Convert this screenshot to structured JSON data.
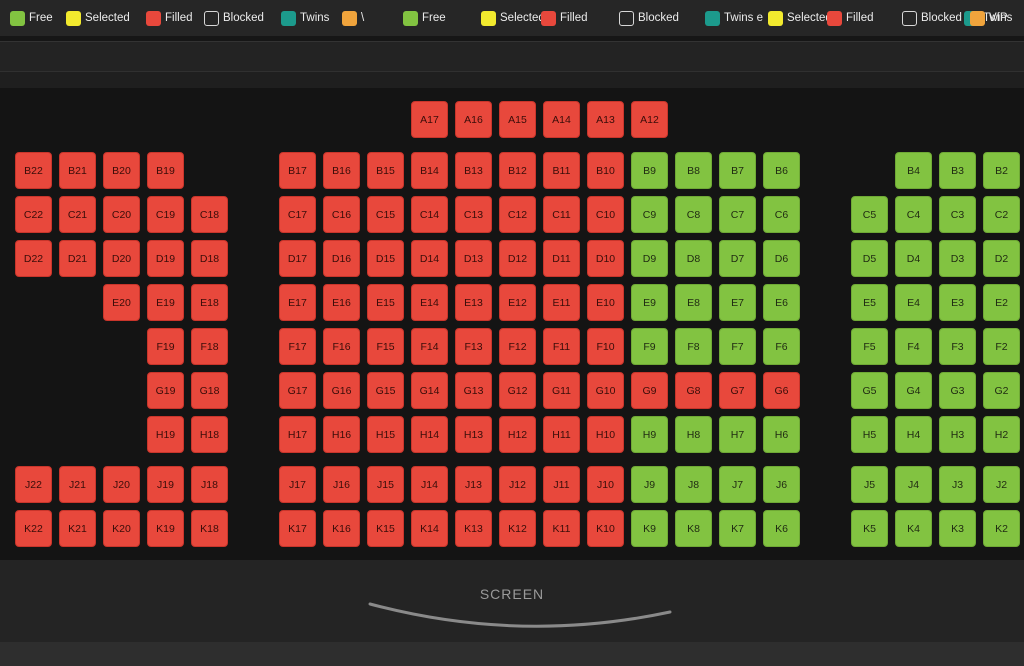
{
  "legend": [
    {
      "label": "Free",
      "status": "free"
    },
    {
      "label": "Selected",
      "status": "selected"
    },
    {
      "label": "Filled",
      "status": "filled"
    },
    {
      "label": "Blocked",
      "status": "blocked"
    },
    {
      "label": "Twins",
      "status": "twins"
    },
    {
      "label": "\\",
      "status": "vip"
    },
    {
      "label": "Free",
      "status": "free"
    },
    {
      "label": "Selected",
      "status": "selected"
    },
    {
      "label": "Filled",
      "status": "filled"
    },
    {
      "label": "Blocked",
      "status": "blocked"
    },
    {
      "label": "Twins e",
      "status": "twins"
    },
    {
      "label": "Selected",
      "status": "selected"
    },
    {
      "label": "Filled",
      "status": "filled"
    },
    {
      "label": "Blocked",
      "status": "blocked"
    },
    {
      "label": "Twins",
      "status": "twins"
    },
    {
      "label": "VIP",
      "status": "vip"
    }
  ],
  "status_colors": {
    "free": "#82c341",
    "selected": "#f2ea2e",
    "filled": "#e8483c",
    "blocked": "transparent",
    "twins": "#1c9a8c",
    "vip": "#f0a43c"
  },
  "seats": {
    "A": {
      "filled": [
        "A17",
        "A16",
        "A15",
        "A14",
        "A13",
        "A12"
      ],
      "free": []
    },
    "B": {
      "filled": [
        "B22",
        "B21",
        "B20",
        "B19",
        "B17",
        "B16",
        "B15",
        "B14",
        "B13",
        "B12",
        "B11",
        "B10"
      ],
      "free": [
        "B9",
        "B8",
        "B7",
        "B6",
        "B4",
        "B3",
        "B2"
      ]
    },
    "C": {
      "filled": [
        "C22",
        "C21",
        "C20",
        "C19",
        "C18",
        "C17",
        "C16",
        "C15",
        "C14",
        "C13",
        "C12",
        "C11",
        "C10"
      ],
      "free": [
        "C9",
        "C8",
        "C7",
        "C6",
        "C5",
        "C4",
        "C3",
        "C2"
      ]
    },
    "D": {
      "filled": [
        "D22",
        "D21",
        "D20",
        "D19",
        "D18",
        "D17",
        "D16",
        "D15",
        "D14",
        "D13",
        "D12",
        "D11",
        "D10"
      ],
      "free": [
        "D9",
        "D8",
        "D7",
        "D6",
        "D5",
        "D4",
        "D3",
        "D2"
      ]
    },
    "E": {
      "filled": [
        "E20",
        "E19",
        "E18",
        "E17",
        "E16",
        "E15",
        "E14",
        "E13",
        "E12",
        "E11",
        "E10"
      ],
      "free": [
        "E9",
        "E8",
        "E7",
        "E6",
        "E5",
        "E4",
        "E3",
        "E2"
      ]
    },
    "F": {
      "filled": [
        "F19",
        "F18",
        "F17",
        "F16",
        "F15",
        "F14",
        "F13",
        "F12",
        "F11",
        "F10"
      ],
      "free": [
        "F9",
        "F8",
        "F7",
        "F6",
        "F5",
        "F4",
        "F3",
        "F2"
      ]
    },
    "G": {
      "filled": [
        "G19",
        "G18",
        "G17",
        "G16",
        "G15",
        "G14",
        "G13",
        "G12",
        "G11",
        "G10",
        "G9",
        "G8",
        "G7",
        "G6"
      ],
      "free": [
        "G5",
        "G4",
        "G3",
        "G2"
      ]
    },
    "H": {
      "filled": [
        "H19",
        "H18",
        "H17",
        "H16",
        "H15",
        "H14",
        "H13",
        "H12",
        "H11",
        "H10"
      ],
      "free": [
        "H9",
        "H8",
        "H7",
        "H6",
        "H5",
        "H4",
        "H3",
        "H2"
      ]
    },
    "J": {
      "filled": [
        "J22",
        "J21",
        "J20",
        "J19",
        "J18",
        "J17",
        "J16",
        "J15",
        "J14",
        "J13",
        "J12",
        "J11",
        "J10"
      ],
      "free": [
        "J9",
        "J8",
        "J7",
        "J6",
        "J5",
        "J4",
        "J3",
        "J2"
      ]
    },
    "K": {
      "filled": [
        "K22",
        "K21",
        "K20",
        "K19",
        "K18",
        "K17",
        "K16",
        "K15",
        "K14",
        "K13",
        "K12",
        "K11",
        "K10"
      ],
      "free": [
        "K9",
        "K8",
        "K7",
        "K6",
        "K5",
        "K4",
        "K3",
        "K2"
      ]
    }
  },
  "screen": {
    "label": "SCREEN"
  }
}
